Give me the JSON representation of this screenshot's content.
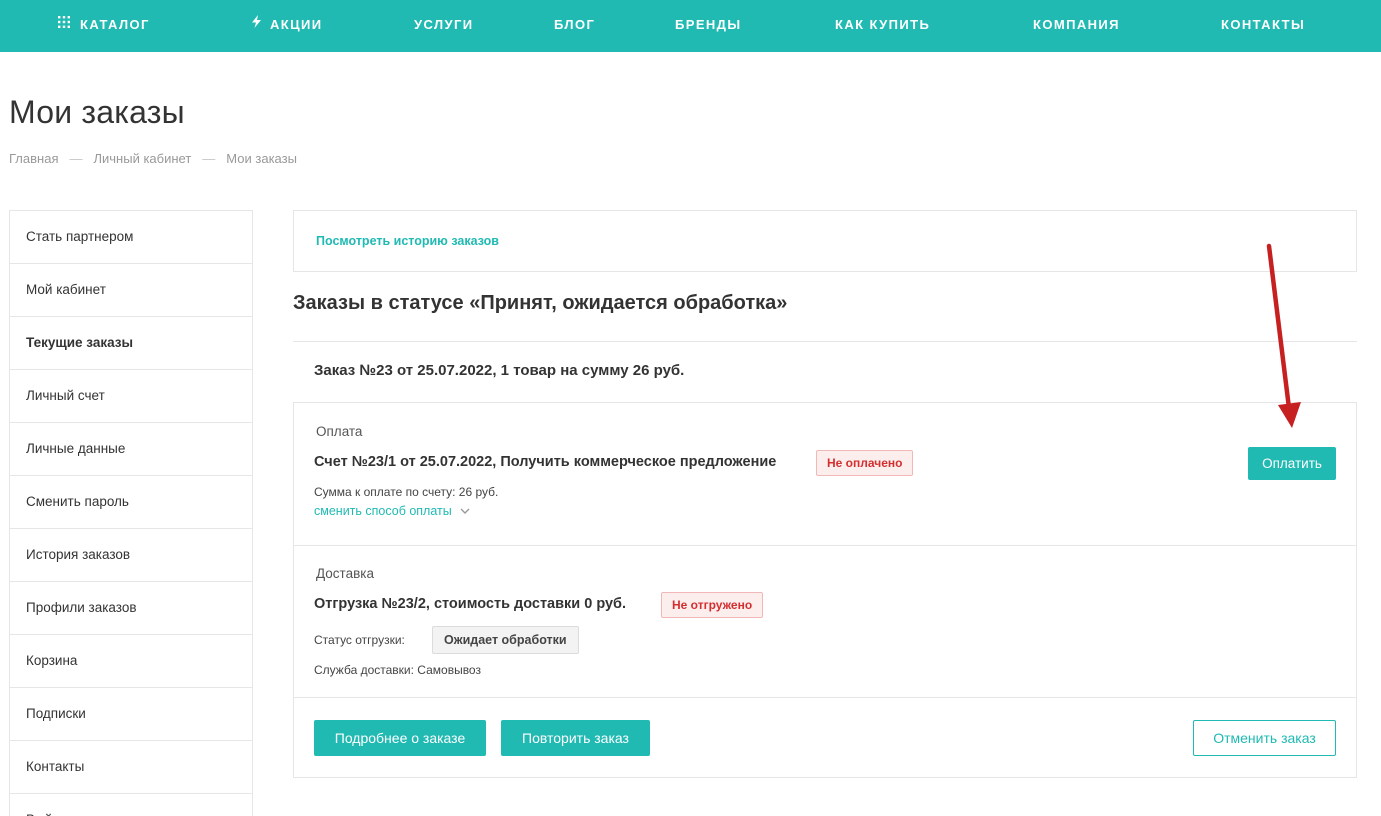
{
  "nav": {
    "items": [
      {
        "label": "КАТАЛОГ",
        "icon": "grid-icon"
      },
      {
        "label": "АКЦИИ",
        "icon": "lightning-icon"
      },
      {
        "label": "УСЛУГИ"
      },
      {
        "label": "БЛОГ"
      },
      {
        "label": "БРЕНДЫ"
      },
      {
        "label": "КАК КУПИТЬ"
      },
      {
        "label": "КОМПАНИЯ"
      },
      {
        "label": "КОНТАКТЫ"
      }
    ]
  },
  "page": {
    "title": "Мои заказы",
    "breadcrumb": [
      "Главная",
      "Личный кабинет",
      "Мои заказы"
    ],
    "breadcrumb_separator": "—"
  },
  "sidebar": {
    "items": [
      {
        "label": "Стать партнером"
      },
      {
        "label": "Мой кабинет"
      },
      {
        "label": "Текущие заказы",
        "active": true
      },
      {
        "label": "Личный счет"
      },
      {
        "label": "Личные данные"
      },
      {
        "label": "Сменить пароль"
      },
      {
        "label": "История заказов"
      },
      {
        "label": "Профили заказов"
      },
      {
        "label": "Корзина"
      },
      {
        "label": "Подписки"
      },
      {
        "label": "Контакты"
      },
      {
        "label": "Выйти"
      }
    ]
  },
  "main": {
    "history_link": "Посмотреть историю заказов",
    "status_heading": "Заказы в статусе «Принят, ожидается обработка»",
    "order": {
      "title": "Заказ №23 от 25.07.2022, 1 товар на сумму 26 руб.",
      "payment": {
        "section_label": "Оплата",
        "title": "Счет №23/1 от 25.07.2022, Получить коммерческое предложение",
        "status_badge": "Не оплачено",
        "sum_label": "Сумма к оплате по счету:",
        "sum_value": "26 руб.",
        "change_method_link": "сменить способ оплаты",
        "pay_button": "Оплатить"
      },
      "delivery": {
        "section_label": "Доставка",
        "title": "Отгрузка №23/2, стоимость доставки 0 руб.",
        "status_badge": "Не отгружено",
        "shipment_status_label": "Статус отгрузки:",
        "shipment_status_value": "Ожидает обработки",
        "service_label": "Служба доставки:",
        "service_value": "Самовывоз"
      },
      "actions": {
        "details_button": "Подробнее о заказе",
        "repeat_button": "Повторить заказ",
        "cancel_button": "Отменить заказ"
      }
    }
  },
  "colors": {
    "accent": "#20bab3",
    "badge_red_text": "#d32f2f",
    "badge_red_bg": "#fdeeee",
    "annotation_arrow": "#c62020"
  }
}
